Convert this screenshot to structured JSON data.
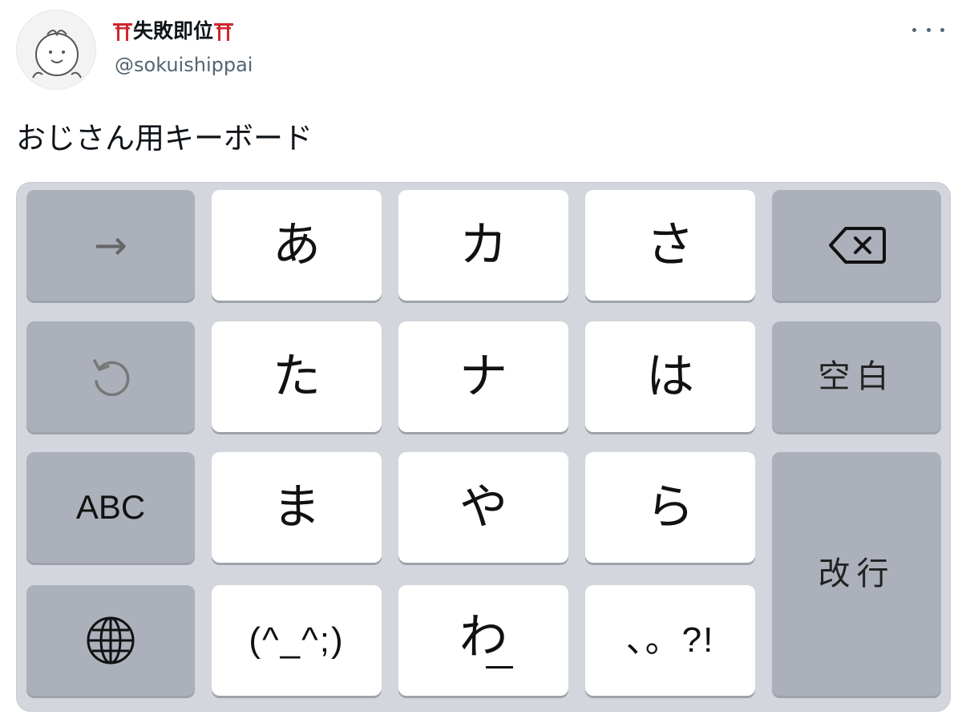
{
  "tweet": {
    "user": {
      "display_name": "失敗即位",
      "handle": "@sokuishippai"
    },
    "text": "おじさん用キーボード"
  },
  "keyboard": {
    "row1": {
      "left": "→",
      "k1": "あ",
      "k2": "カ",
      "k3": "さ",
      "right_icon": "backspace-icon"
    },
    "row2": {
      "left_icon": "undo-icon",
      "k1": "た",
      "k2": "ナ",
      "k3": "は",
      "right": "空白"
    },
    "row3": {
      "left": "ABC",
      "k1": "ま",
      "k2": "や",
      "k3": "ら",
      "right": "改行"
    },
    "row4": {
      "left_icon": "globe-icon",
      "k1": "(^_^;)",
      "k2": "わ",
      "k3": "、。?!"
    }
  },
  "colors": {
    "keyboard_bg": "#d3d6dc",
    "key_light": "#ffffff",
    "key_dark": "#abb0ba",
    "torii_red": "#d0262f",
    "handle_gray": "#536471"
  }
}
